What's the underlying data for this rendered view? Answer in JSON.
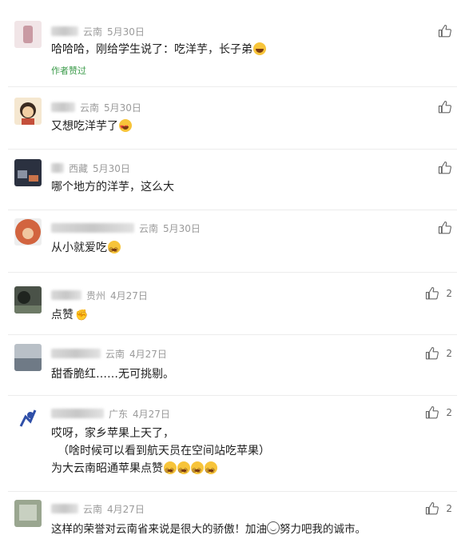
{
  "comments": [
    {
      "region": "云南",
      "date": "5月30日",
      "text": "哈哈哈，刚给学生说了：吃洋芋，长子弟",
      "emoji": "laugh-emoji",
      "author_liked": "作者赞过",
      "likes": "",
      "avatar_color": "#d3b0b6"
    },
    {
      "region": "云南",
      "date": "5月30日",
      "text": "又想吃洋芋了",
      "emoji": "heart-eyes-emoji",
      "likes": "",
      "avatar_color": "#c79c6f"
    },
    {
      "region": "西藏",
      "date": "5月30日",
      "text": "哪个地方的洋芋，这么大",
      "likes": "",
      "avatar_color": "#2d3342"
    },
    {
      "region": "云南",
      "date": "5月30日",
      "text": "从小就爱吃",
      "emoji": "dizzy-emoji",
      "likes": "",
      "avatar_color": "#c05a3a"
    },
    {
      "region": "贵州",
      "date": "4月27日",
      "text": "点赞",
      "emoji": "fist-emoji",
      "likes": "2",
      "avatar_color": "#3a3f3a"
    },
    {
      "region": "云南",
      "date": "4月27日",
      "text": "甜香脆红……无可挑剔。",
      "likes": "2",
      "avatar_color": "#9aa3ad"
    },
    {
      "region": "广东",
      "date": "4月27日",
      "lines": [
        "哎呀，家乡苹果上天了，",
        "（啥时候可以看到航天员在空间站吃苹果）",
        "为大云南昭通苹果点赞"
      ],
      "emoji_count": 4,
      "likes": "2",
      "avatar_color": "#3355aa"
    },
    {
      "region": "云南",
      "date": "4月27日",
      "text": "这样的荣誉对云南省来说是很大的骄傲！加油",
      "text_after": "努力吧我的诚市。",
      "likes": "2",
      "avatar_color": "#8f9c8a"
    }
  ]
}
